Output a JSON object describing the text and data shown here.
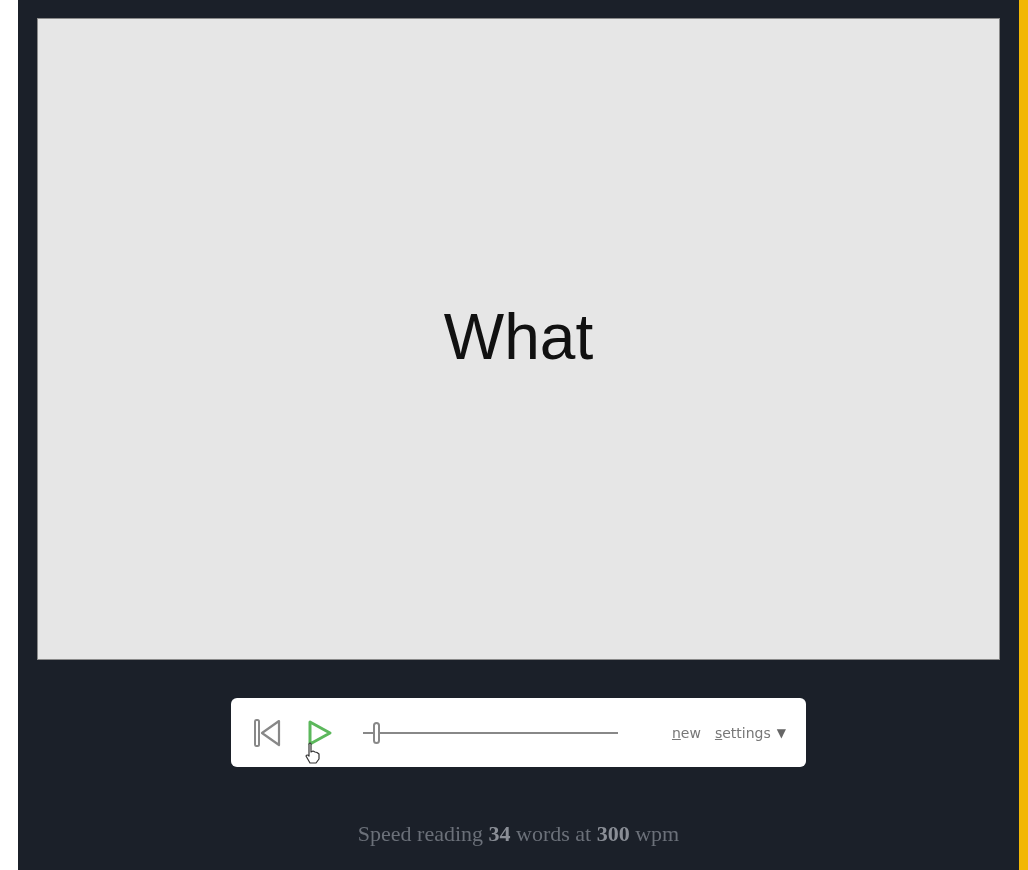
{
  "display": {
    "word": "What"
  },
  "controls": {
    "progress": {
      "level": 0.04
    },
    "links": [
      "new",
      "settings"
    ],
    "dropdown_arrow": "▼"
  },
  "footer": {
    "text": "Speed reading **34** words at **300** wpm"
  }
}
